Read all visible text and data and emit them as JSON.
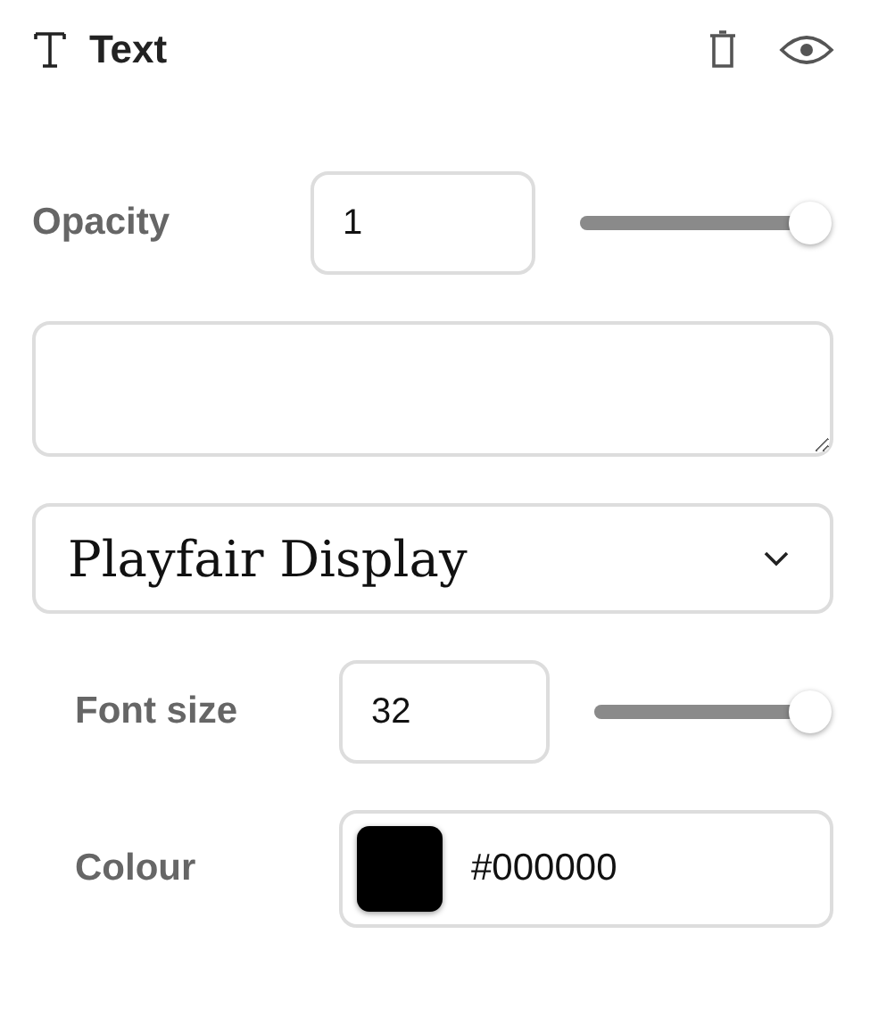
{
  "header": {
    "title": "Text"
  },
  "opacity": {
    "label": "Opacity",
    "value": "1",
    "level": 1
  },
  "font_select": {
    "value": "Playfair Display"
  },
  "font_size": {
    "label": "Font size",
    "value": "32",
    "level": 1
  },
  "colour": {
    "label": "Colour",
    "value": "#000000"
  }
}
